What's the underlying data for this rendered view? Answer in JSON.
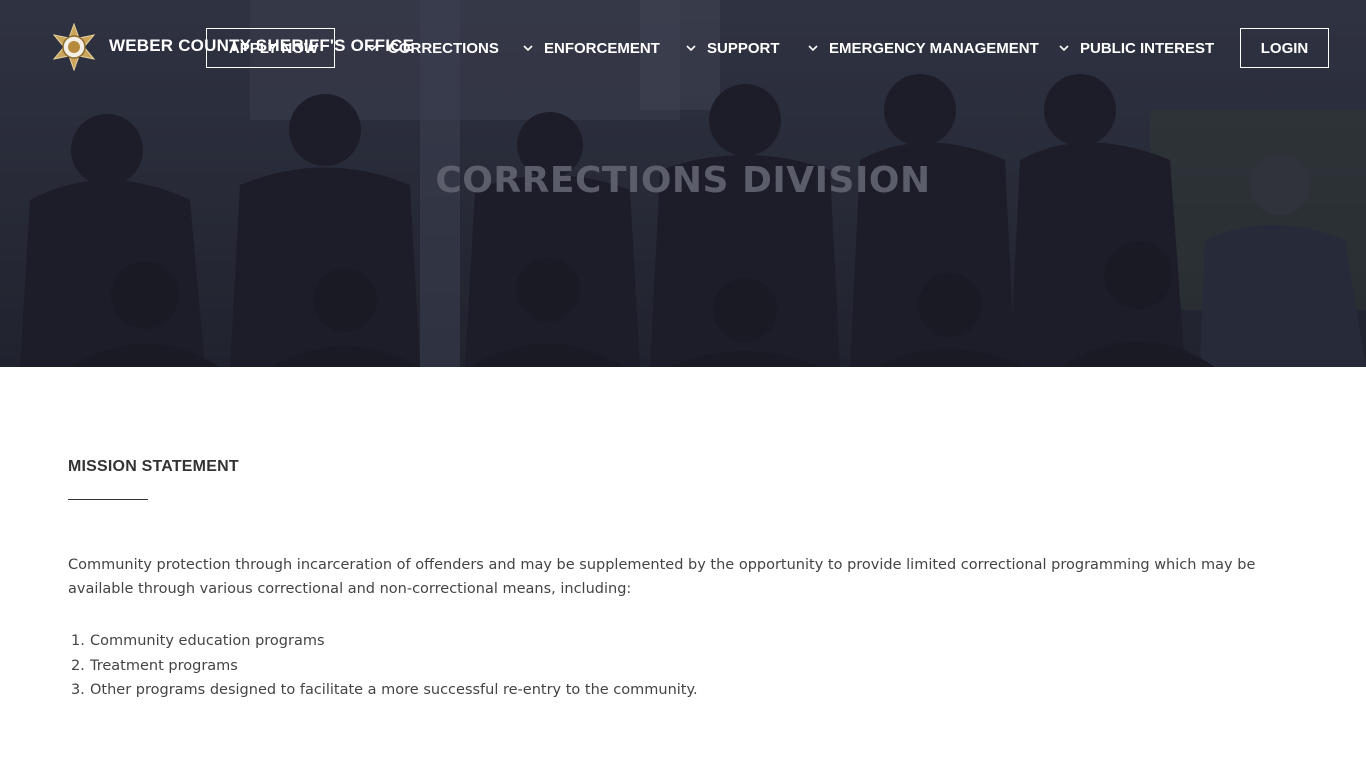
{
  "header": {
    "site_name": "WEBER COUNTY SHERIFF'S OFFICE",
    "apply_label": "APPLY NOW",
    "nav": [
      {
        "label": "CORRECTIONS"
      },
      {
        "label": "ENFORCEMENT"
      },
      {
        "label": "SUPPORT"
      },
      {
        "label": "EMERGENCY MANAGEMENT"
      },
      {
        "label": "PUBLIC INTEREST"
      }
    ],
    "login_label": "LOGIN"
  },
  "hero": {
    "title": "CORRECTIONS DIVISION"
  },
  "main": {
    "heading": "MISSION STATEMENT",
    "paragraph": "Community protection through incarceration of offenders and may be supplemented by the opportunity to provide limited correctional programming which may be available through various correctional and non-correctional means, including:",
    "list": [
      {
        "num": "1.",
        "text": "Community education programs"
      },
      {
        "num": "2.",
        "text": "Treatment programs"
      },
      {
        "num": "3.",
        "text": "Other programs designed to facilitate a more successful re-entry to the community."
      }
    ]
  },
  "colors": {
    "hero_bg": "#2b2e3b",
    "nav_text": "#ffffff",
    "body_text": "#444444",
    "heading_text": "#333333"
  }
}
